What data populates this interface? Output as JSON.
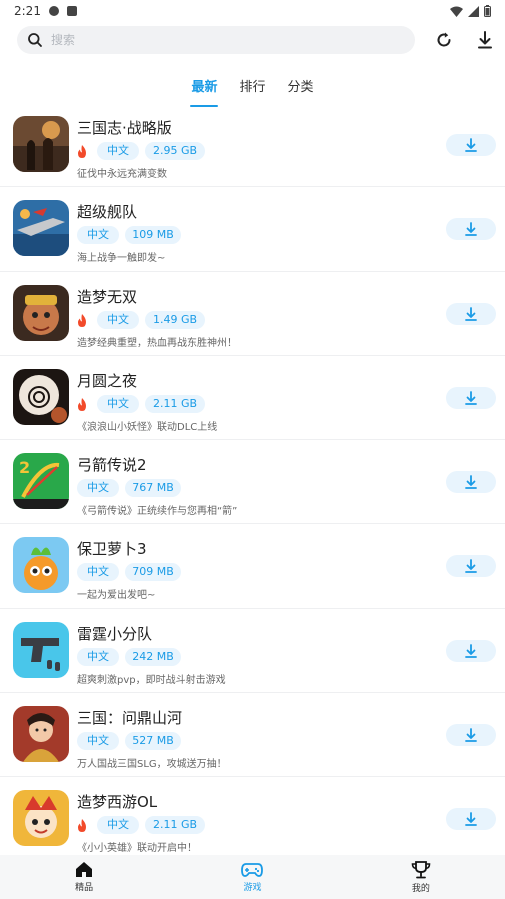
{
  "status_bar": {
    "time": "2:21"
  },
  "search": {
    "placeholder": "搜索"
  },
  "tabs": [
    {
      "label": "最新",
      "active": true
    },
    {
      "label": "排行",
      "active": false
    },
    {
      "label": "分类",
      "active": false
    }
  ],
  "games": [
    {
      "name": "三国志·战略版",
      "hot": true,
      "lang": "中文",
      "size": "2.95 GB",
      "desc": "征伐中永远充满变数",
      "icon": "game-icon-sanguozhi"
    },
    {
      "name": "超级舰队",
      "hot": false,
      "lang": "中文",
      "size": "109 MB",
      "desc": "海上战争一触即发~",
      "icon": "game-icon-fleet"
    },
    {
      "name": "造梦无双",
      "hot": true,
      "lang": "中文",
      "size": "1.49 GB",
      "desc": "造梦经典重塑，热血再战东胜神州！",
      "icon": "game-icon-zaomeng"
    },
    {
      "name": "月圆之夜",
      "hot": true,
      "lang": "中文",
      "size": "2.11 GB",
      "desc": "《浪浪山小妖怪》联动DLC上线",
      "icon": "game-icon-moon"
    },
    {
      "name": "弓箭传说2",
      "hot": false,
      "lang": "中文",
      "size": "767 MB",
      "desc": "《弓箭传说》正统续作与您再相“箭”",
      "icon": "game-icon-archero"
    },
    {
      "name": "保卫萝卜3",
      "hot": false,
      "lang": "中文",
      "size": "709 MB",
      "desc": "一起为爱出发吧~",
      "icon": "game-icon-carrot"
    },
    {
      "name": "雷霆小分队",
      "hot": false,
      "lang": "中文",
      "size": "242 MB",
      "desc": "超爽刺激pvp，即时战斗射击游戏",
      "icon": "game-icon-gun"
    },
    {
      "name": "三国：问鼎山河",
      "hot": false,
      "lang": "中文",
      "size": "527 MB",
      "desc": "万人国战三国SLG，攻城送万抽！",
      "icon": "game-icon-wending"
    },
    {
      "name": "造梦西游OL",
      "hot": true,
      "lang": "中文",
      "size": "2.11 GB",
      "desc": "《小小英雄》联动开启中！",
      "icon": "game-icon-xiyou"
    }
  ],
  "bottom_nav": [
    {
      "label": "精品",
      "icon": "home-icon",
      "active": false
    },
    {
      "label": "游戏",
      "icon": "gamepad-icon",
      "active": true
    },
    {
      "label": "我的",
      "icon": "trophy-icon",
      "active": false
    }
  ],
  "colors": {
    "accent": "#1a9be6",
    "tag_bg": "#e8f4fd",
    "hot": "#f24a2a"
  }
}
